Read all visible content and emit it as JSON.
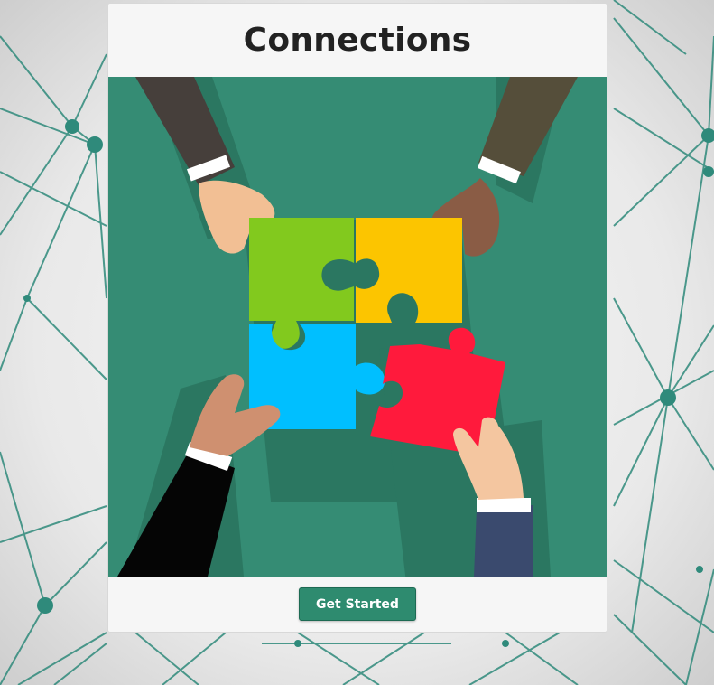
{
  "page": {
    "title": "Connections"
  },
  "hero": {
    "alt": "hands connecting puzzle pieces"
  },
  "actions": {
    "get_started_label": "Get Started"
  },
  "colors": {
    "accent": "#2e8b6f",
    "hero_background": "#358c74",
    "puzzle_green": "#82c91e",
    "puzzle_yellow": "#fcc500",
    "puzzle_blue": "#00bfff",
    "puzzle_red": "#ff1a3c"
  }
}
